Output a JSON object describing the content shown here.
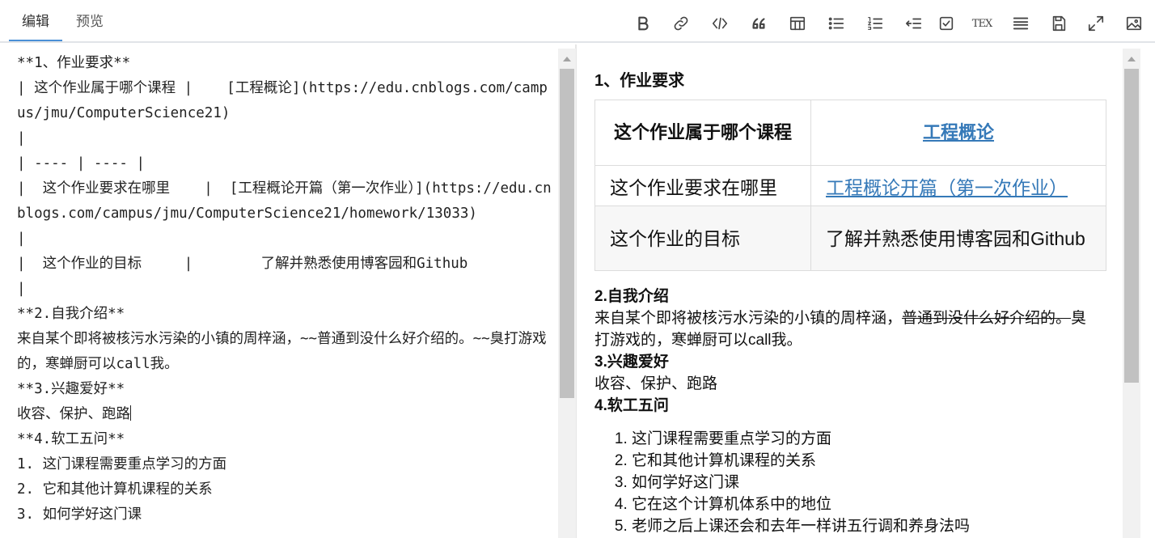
{
  "tabs": {
    "edit": "编辑",
    "preview": "预览"
  },
  "toolbar": [
    {
      "name": "bold-icon",
      "kind": "bold"
    },
    {
      "name": "link-icon",
      "kind": "link"
    },
    {
      "name": "code-icon",
      "kind": "code"
    },
    {
      "name": "quote-icon",
      "kind": "quote"
    },
    {
      "name": "table-icon",
      "kind": "table"
    },
    {
      "name": "unordered-list-icon",
      "kind": "ul"
    },
    {
      "name": "ordered-list-icon",
      "kind": "ol"
    },
    {
      "name": "indent-icon",
      "kind": "indent"
    },
    {
      "name": "checkbox-icon",
      "kind": "check"
    },
    {
      "name": "tex-icon",
      "kind": "tex",
      "label": "TEX"
    },
    {
      "name": "align-icon",
      "kind": "align"
    },
    {
      "name": "save-icon",
      "kind": "save"
    },
    {
      "name": "fullscreen-icon",
      "kind": "fullscreen"
    },
    {
      "name": "image-icon",
      "kind": "image"
    }
  ],
  "editor": {
    "lines": [
      "**1、作业要求**",
      "| 这个作业属于哪个课程 |    [工程概论](https://edu.cnblogs.com/campus/jmu/ComputerScience21)",
      "|",
      "| ---- | ---- |",
      "|  这个作业要求在哪里    |  [工程概论开篇（第一次作业）](https://edu.cnblogs.com/campus/jmu/ComputerScience21/homework/13033)         |",
      "|  这个作业的目标     |        了解并熟悉使用博客园和Github",
      "|",
      "",
      "**2.自我介绍**",
      "来自某个即将被核污水污染的小镇的周梓涵，~~普通到没什么好介绍的。~~臭打游戏的，寒蝉厨可以call我。",
      "**3.兴趣爱好**",
      "收容、保护、跑路",
      "**4.软工五问**",
      "1. 这门课程需要重点学习的方面",
      "2. 它和其他计算机课程的关系",
      "3. 如何学好这门课"
    ]
  },
  "preview": {
    "h1": "1、作业要求",
    "table": {
      "header": {
        "label": "这个作业属于哪个课程",
        "link": "工程概论"
      },
      "rows": [
        {
          "label": "这个作业要求在哪里",
          "link": "工程概论开篇（第一次作业）"
        },
        {
          "label": "这个作业的目标",
          "value": "了解并熟悉使用博客园和Github"
        }
      ]
    },
    "intro_heading": "2.自我介绍",
    "intro_text_before": "来自某个即将被核污水污染的小镇的周梓涵，",
    "intro_strike": "普通到没什么好介绍的。",
    "intro_text_after": "臭打游戏的，寒蝉厨可以call我。",
    "hobby_heading": "3.兴趣爱好",
    "hobby_text": "收容、保护、跑路",
    "questions_heading": "4.软工五问",
    "questions": [
      "这门课程需要重点学习的方面",
      "它和其他计算机课程的关系",
      "如何学好这门课",
      "它在这个计算机体系中的地位",
      "老师之后上课还会和去年一样讲五行调和养身法吗"
    ]
  }
}
